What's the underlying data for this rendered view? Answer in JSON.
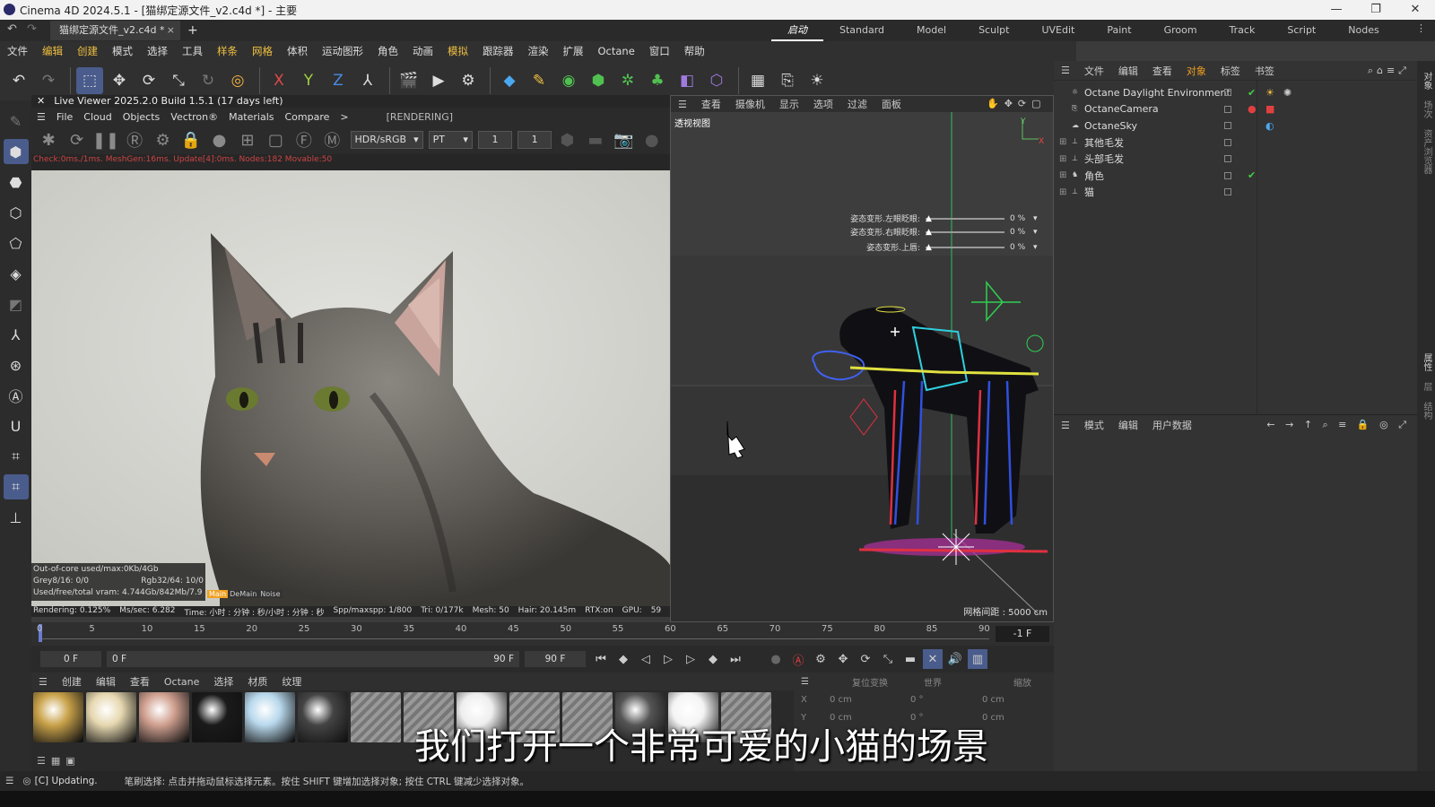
{
  "window": {
    "title": "Cinema 4D 2024.5.1 - [猫绑定源文件_v2.c4d *] - 主要",
    "controls": [
      "—",
      "❐",
      "✕"
    ]
  },
  "tabs": {
    "document": "猫绑定源文件_v2.c4d *",
    "close": "×",
    "add": "+"
  },
  "layouts": [
    "启动",
    "Standard",
    "Model",
    "Sculpt",
    "UVEdit",
    "Paint",
    "Groom",
    "Track",
    "Script",
    "Nodes"
  ],
  "menu": [
    "文件",
    "编辑",
    "创建",
    "模式",
    "选择",
    "工具",
    "样条",
    "网格",
    "体积",
    "运动图形",
    "角色",
    "动画",
    "模拟",
    "跟踪器",
    "渲染",
    "扩展",
    "Octane",
    "窗口",
    "帮助"
  ],
  "live_viewer": {
    "header": "Live Viewer 2025.2.0 Build 1.5.1 (17 days left)",
    "menu": [
      "File",
      "Cloud",
      "Objects",
      "Vectron®",
      "Materials",
      "Compare",
      ">"
    ],
    "status": "[RENDERING]",
    "colorspace": "HDR/sRGB",
    "kernel": "PT",
    "field1": "1",
    "field2": "1",
    "stat_line": "Check:0ms./1ms. MeshGen:16ms. Update[4]:0ms. Nodes:182 Movable:50",
    "info": {
      "out_of_core": "Out-of-core used/max:0Kb/4Gb",
      "grey": "Grey8/16: 0/0",
      "rgb": "Rgb32/64: 10/0",
      "vram": "Used/free/total vram: 4.744Gb/842Mb/7.9",
      "tabs": [
        "Main",
        "DeMain",
        "Noise"
      ]
    },
    "render_stats": [
      "Rendering: 0.125%",
      "Ms/sec: 6.282",
      "Time: 小时 : 分钟 : 秒/小时 : 分钟 : 秒",
      "Spp/maxspp: 1/800",
      "Tri: 0/177k",
      "Mesh: 50",
      "Hair: 20.145m",
      "RTX:on",
      "GPU:",
      "59"
    ]
  },
  "viewport": {
    "menu": [
      "查看",
      "摄像机",
      "显示",
      "选项",
      "过滤",
      "面板"
    ],
    "label": "透视视图",
    "grid": "网格间距 : 5000 cm",
    "sliders": [
      {
        "label": "姿态变形.左眼眨眼:",
        "value": "0 %"
      },
      {
        "label": "姿态变形.右眼眨眼:",
        "value": "0 %"
      },
      {
        "label": "姿态变形.上唇:",
        "value": "0 %"
      }
    ]
  },
  "object_panel": {
    "menu": [
      "文件",
      "编辑",
      "查看",
      "对象",
      "标签",
      "书签"
    ],
    "active_menu": "对象",
    "objects": [
      {
        "name": "Octane Daylight Environment",
        "expand": "",
        "tag": "✔"
      },
      {
        "name": "OctaneCamera",
        "expand": "",
        "tag": "●"
      },
      {
        "name": "OctaneSky",
        "expand": "",
        "tag": "◐"
      },
      {
        "name": "其他毛发",
        "expand": "⊞",
        "tag": ""
      },
      {
        "name": "头部毛发",
        "expand": "⊞",
        "tag": ""
      },
      {
        "name": "角色",
        "expand": "⊞",
        "tag": "✔"
      },
      {
        "name": "猫",
        "expand": "⊞",
        "tag": ""
      }
    ]
  },
  "attr_panel": {
    "menu": [
      "模式",
      "编辑",
      "用户数据"
    ]
  },
  "right_strip": [
    "对象",
    "场次",
    "资产浏览器",
    "属性",
    "层",
    "结构"
  ],
  "timeline": {
    "ticks": [
      "0",
      "5",
      "10",
      "15",
      "20",
      "25",
      "30",
      "35",
      "40",
      "45",
      "50",
      "55",
      "60",
      "65",
      "70",
      "75",
      "80",
      "85",
      "90"
    ],
    "current": "-1 F",
    "start": "0 F",
    "start2": "0 F",
    "end": "90 F",
    "end2": "90 F"
  },
  "material_menu": [
    "创建",
    "编辑",
    "查看",
    "Octane",
    "选择",
    "材质",
    "纹理"
  ],
  "materials": [
    {
      "color": "#c9a24a"
    },
    {
      "color": "#e6d8b0"
    },
    {
      "color": "#d0a090"
    },
    {
      "color": "#1a1a1a"
    },
    {
      "color": "#b8d8ec"
    },
    {
      "color": "#444444"
    },
    {
      "color": "#888888"
    },
    {
      "color": "#888888"
    },
    {
      "color": "#eeeeee"
    },
    {
      "color": "#888888"
    },
    {
      "color": "#888888"
    },
    {
      "color": "#555555"
    },
    {
      "color": "#f4f4f4"
    },
    {
      "color": "#888888"
    }
  ],
  "coords": {
    "header": [
      "复位变换",
      "世界",
      "缩放"
    ],
    "rows": [
      {
        "axis": "X",
        "pos": "0 cm",
        "rot": "0 °",
        "size": "0 cm"
      },
      {
        "axis": "Y",
        "pos": "0 cm",
        "rot": "0 °",
        "size": "0 cm"
      }
    ]
  },
  "statusbar": {
    "updating": "[C]  Updating.",
    "hint": "笔刷选择: 点击并拖动鼠标选择元素。按住 SHIFT 键增加选择对象; 按住 CTRL 键减少选择对象。"
  },
  "subtitle": "我们打开一个非常可爱的小猫的场景"
}
